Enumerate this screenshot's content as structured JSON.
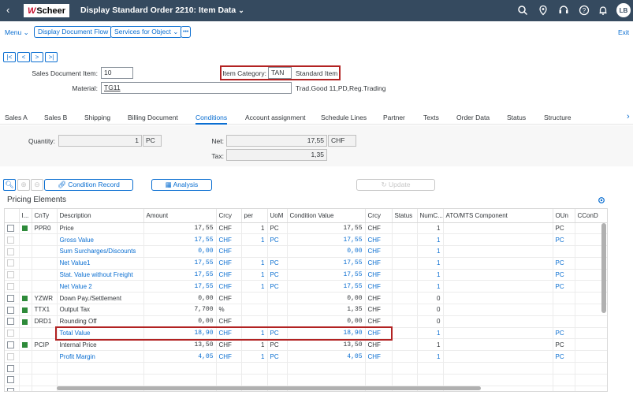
{
  "shell": {
    "logo_mark": "W",
    "logo_text": "Scheer",
    "title": "Display Standard Order 2210: Item Data",
    "avatar": "LB",
    "icons": [
      "back-icon",
      "search-icon",
      "location-icon",
      "headset-icon",
      "help-icon",
      "bell-icon"
    ]
  },
  "toolbar": {
    "menu": "Menu",
    "display_document_flow": "Display Document Flow",
    "services_for_object": "Services for Object",
    "more": "•••",
    "exit": "Exit"
  },
  "nav": {
    "first": "|<",
    "prev": "<",
    "next": ">",
    "last": ">|"
  },
  "header": {
    "sales_doc_item_label": "Sales Document Item:",
    "sales_doc_item_value": "10",
    "item_category_label": "Item Category:",
    "item_category_value": "TAN",
    "item_category_text": "Standard Item",
    "material_label": "Material:",
    "material_value": "TG11",
    "material_desc": "Trad.Good 11,PD,Reg.Trading"
  },
  "tabs": [
    "Sales A",
    "Sales B",
    "Shipping",
    "Billing Document",
    "Conditions",
    "Account assignment",
    "Schedule Lines",
    "Partner",
    "Texts",
    "Order Data",
    "Status",
    "Structure"
  ],
  "active_tab": "Conditions",
  "conditions": {
    "quantity_label": "Quantity:",
    "quantity_value": "1",
    "quantity_unit": "PC",
    "net_label": "Net:",
    "net_value": "17,55",
    "net_currency": "CHF",
    "tax_label": "Tax:",
    "tax_value": "1,35"
  },
  "pricing_toolbar": {
    "condition_record": "Condition Record",
    "analysis": "Analysis",
    "update": "Update"
  },
  "pricing": {
    "title": "Pricing Elements",
    "columns": [
      "I...",
      "CnTy",
      "Description",
      "Amount",
      "Crcy",
      "per",
      "UoM",
      "Condition Value",
      "Crcy",
      "Status",
      "NumC...",
      "ATO/MTS Component",
      "OUn",
      "CConD"
    ],
    "rows": [
      {
        "check": true,
        "status": true,
        "cnty": "PPR0",
        "desc": "Price",
        "link": false,
        "amount": "17,55",
        "crcy": "CHF",
        "per": "1",
        "uom": "PC",
        "cval": "17,55",
        "ccrcy": "CHF",
        "numc": "1",
        "oun": "PC"
      },
      {
        "check": false,
        "status": false,
        "cnty": "",
        "desc": "Gross Value",
        "link": true,
        "amount": "17,55",
        "crcy": "CHF",
        "per": "1",
        "uom": "PC",
        "cval": "17,55",
        "ccrcy": "CHF",
        "numc": "1",
        "oun": "PC"
      },
      {
        "check": false,
        "status": false,
        "cnty": "",
        "desc": "Sum Surcharges/Discounts",
        "link": true,
        "amount": "0,00",
        "crcy": "CHF",
        "per": "",
        "uom": "",
        "cval": "0,00",
        "ccrcy": "CHF",
        "numc": "1",
        "oun": ""
      },
      {
        "check": false,
        "status": false,
        "cnty": "",
        "desc": "Net Value1",
        "link": true,
        "amount": "17,55",
        "crcy": "CHF",
        "per": "1",
        "uom": "PC",
        "cval": "17,55",
        "ccrcy": "CHF",
        "numc": "1",
        "oun": "PC"
      },
      {
        "check": false,
        "status": false,
        "cnty": "",
        "desc": "Stat. Value without Freight",
        "link": true,
        "amount": "17,55",
        "crcy": "CHF",
        "per": "1",
        "uom": "PC",
        "cval": "17,55",
        "ccrcy": "CHF",
        "numc": "1",
        "oun": "PC"
      },
      {
        "check": false,
        "status": false,
        "cnty": "",
        "desc": "Net Value 2",
        "link": true,
        "amount": "17,55",
        "crcy": "CHF",
        "per": "1",
        "uom": "PC",
        "cval": "17,55",
        "ccrcy": "CHF",
        "numc": "1",
        "oun": "PC"
      },
      {
        "check": true,
        "status": true,
        "cnty": "YZWR",
        "desc": "Down Pay./Settlement",
        "link": false,
        "amount": "0,00",
        "crcy": "CHF",
        "per": "",
        "uom": "",
        "cval": "0,00",
        "ccrcy": "CHF",
        "numc": "0",
        "oun": ""
      },
      {
        "check": true,
        "status": true,
        "cnty": "TTX1",
        "desc": "Output Tax",
        "link": false,
        "amount": "7,700",
        "crcy": "%",
        "per": "",
        "uom": "",
        "cval": "1,35",
        "ccrcy": "CHF",
        "numc": "0",
        "oun": ""
      },
      {
        "check": true,
        "status": true,
        "cnty": "DRD1",
        "desc": "Rounding Off",
        "link": false,
        "amount": "0,00",
        "crcy": "CHF",
        "per": "",
        "uom": "",
        "cval": "0,00",
        "ccrcy": "CHF",
        "numc": "0",
        "oun": ""
      },
      {
        "check": false,
        "status": false,
        "cnty": "",
        "desc": "Total Value",
        "link": true,
        "amount": "18,90",
        "crcy": "CHF",
        "per": "1",
        "uom": "PC",
        "cval": "18,90",
        "ccrcy": "CHF",
        "numc": "1",
        "oun": "PC"
      },
      {
        "check": true,
        "status": true,
        "cnty": "PCIP",
        "desc": "Internal Price",
        "link": false,
        "amount": "13,50",
        "crcy": "CHF",
        "per": "1",
        "uom": "PC",
        "cval": "13,50",
        "ccrcy": "CHF",
        "numc": "1",
        "oun": "PC"
      },
      {
        "check": false,
        "status": false,
        "cnty": "",
        "desc": "Profit Margin",
        "link": true,
        "amount": "4,05",
        "crcy": "CHF",
        "per": "1",
        "uom": "PC",
        "cval": "4,05",
        "ccrcy": "CHF",
        "numc": "1",
        "oun": "PC"
      },
      {
        "check": true,
        "empty": true
      },
      {
        "check": true,
        "empty": true
      },
      {
        "check": true,
        "empty": true
      }
    ]
  },
  "colors": {
    "shell": "#354a5f",
    "accent": "#0a6ed1",
    "highlight": "#b22222",
    "status_green": "#2e8b3a"
  }
}
